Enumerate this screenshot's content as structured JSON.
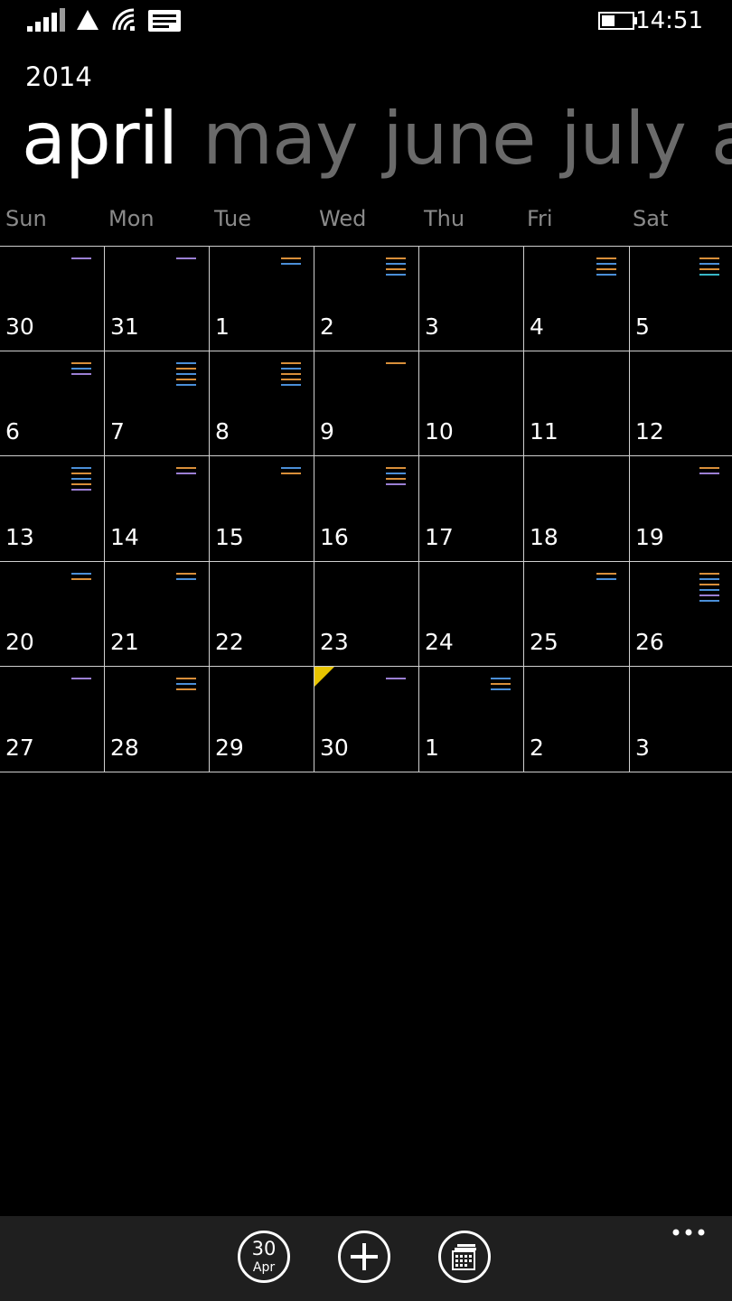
{
  "status": {
    "time": "14:51"
  },
  "header": {
    "year": "2014",
    "months": [
      "april",
      "may",
      "june",
      "july",
      "augu"
    ]
  },
  "weekdays": [
    "Sun",
    "Mon",
    "Tue",
    "Wed",
    "Thu",
    "Fri",
    "Sat"
  ],
  "days": [
    [
      {
        "day": "30",
        "events": [
          "purple"
        ]
      },
      {
        "day": "31",
        "events": [
          "purple"
        ]
      },
      {
        "day": "1",
        "events": [
          "orange",
          "blue"
        ]
      },
      {
        "day": "2",
        "events": [
          "orange",
          "blue",
          "orange",
          "blue"
        ]
      },
      {
        "day": "3",
        "events": []
      },
      {
        "day": "4",
        "events": [
          "orange",
          "blue",
          "orange",
          "blue"
        ]
      },
      {
        "day": "5",
        "events": [
          "orange",
          "blue",
          "orange",
          "teal"
        ]
      }
    ],
    [
      {
        "day": "6",
        "events": [
          "orange",
          "blue",
          "purple"
        ]
      },
      {
        "day": "7",
        "events": [
          "blue",
          "orange",
          "blue",
          "orange",
          "blue"
        ]
      },
      {
        "day": "8",
        "events": [
          "orange",
          "blue",
          "orange",
          "orange",
          "blue"
        ]
      },
      {
        "day": "9",
        "events": [
          "orange"
        ]
      },
      {
        "day": "10",
        "events": []
      },
      {
        "day": "11",
        "events": []
      },
      {
        "day": "12",
        "events": []
      }
    ],
    [
      {
        "day": "13",
        "events": [
          "blue",
          "orange",
          "blue",
          "orange",
          "purple"
        ]
      },
      {
        "day": "14",
        "events": [
          "orange",
          "purple"
        ]
      },
      {
        "day": "15",
        "events": [
          "blue",
          "orange"
        ]
      },
      {
        "day": "16",
        "events": [
          "orange",
          "blue",
          "orange",
          "purple"
        ]
      },
      {
        "day": "17",
        "events": []
      },
      {
        "day": "18",
        "events": []
      },
      {
        "day": "19",
        "events": [
          "orange",
          "purple"
        ]
      }
    ],
    [
      {
        "day": "20",
        "events": [
          "blue",
          "orange"
        ]
      },
      {
        "day": "21",
        "events": [
          "orange",
          "blue"
        ]
      },
      {
        "day": "22",
        "events": []
      },
      {
        "day": "23",
        "events": []
      },
      {
        "day": "24",
        "events": []
      },
      {
        "day": "25",
        "events": [
          "orange",
          "blue"
        ]
      },
      {
        "day": "26",
        "events": [
          "orange",
          "blue",
          "orange",
          "blue",
          "purple",
          "blue"
        ]
      }
    ],
    [
      {
        "day": "27",
        "events": [
          "purple"
        ]
      },
      {
        "day": "28",
        "events": [
          "orange",
          "blue",
          "orange"
        ]
      },
      {
        "day": "29",
        "events": []
      },
      {
        "day": "30",
        "events": [
          "purple"
        ],
        "today": true
      },
      {
        "day": "1",
        "events": [
          "blue",
          "orange",
          "blue"
        ]
      },
      {
        "day": "2",
        "events": []
      },
      {
        "day": "3",
        "events": []
      }
    ]
  ],
  "event_colors": {
    "orange": "#d98f3a",
    "blue": "#4b8fd8",
    "purple": "#9b7fd4",
    "teal": "#38b7c7"
  },
  "today_flag_color": "#e8c400",
  "appbar": {
    "today_day": "30",
    "today_month": "Apr"
  }
}
